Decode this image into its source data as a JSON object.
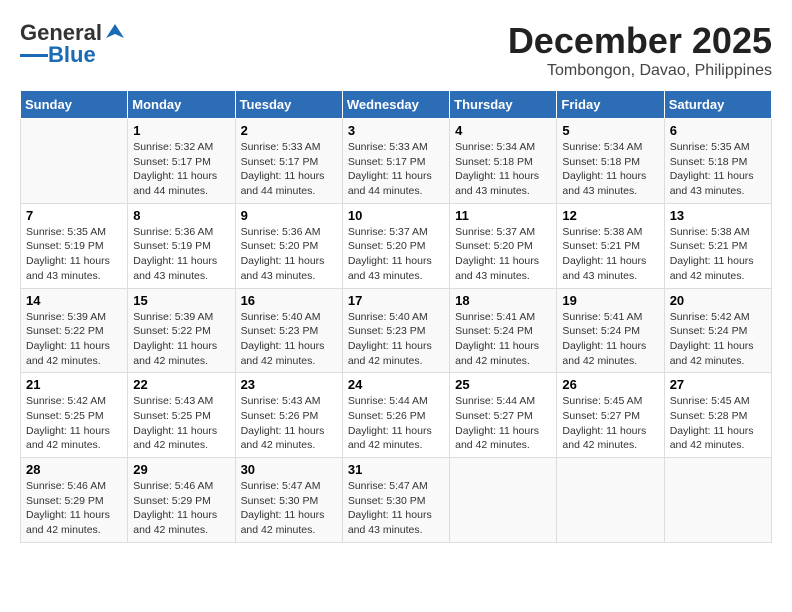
{
  "header": {
    "logo_general": "General",
    "logo_blue": "Blue",
    "title": "December 2025",
    "subtitle": "Tombongon, Davao, Philippines"
  },
  "calendar": {
    "days_of_week": [
      "Sunday",
      "Monday",
      "Tuesday",
      "Wednesday",
      "Thursday",
      "Friday",
      "Saturday"
    ],
    "weeks": [
      [
        {
          "day": "",
          "info": ""
        },
        {
          "day": "1",
          "info": "Sunrise: 5:32 AM\nSunset: 5:17 PM\nDaylight: 11 hours\nand 44 minutes."
        },
        {
          "day": "2",
          "info": "Sunrise: 5:33 AM\nSunset: 5:17 PM\nDaylight: 11 hours\nand 44 minutes."
        },
        {
          "day": "3",
          "info": "Sunrise: 5:33 AM\nSunset: 5:17 PM\nDaylight: 11 hours\nand 44 minutes."
        },
        {
          "day": "4",
          "info": "Sunrise: 5:34 AM\nSunset: 5:18 PM\nDaylight: 11 hours\nand 43 minutes."
        },
        {
          "day": "5",
          "info": "Sunrise: 5:34 AM\nSunset: 5:18 PM\nDaylight: 11 hours\nand 43 minutes."
        },
        {
          "day": "6",
          "info": "Sunrise: 5:35 AM\nSunset: 5:18 PM\nDaylight: 11 hours\nand 43 minutes."
        }
      ],
      [
        {
          "day": "7",
          "info": "Sunrise: 5:35 AM\nSunset: 5:19 PM\nDaylight: 11 hours\nand 43 minutes."
        },
        {
          "day": "8",
          "info": "Sunrise: 5:36 AM\nSunset: 5:19 PM\nDaylight: 11 hours\nand 43 minutes."
        },
        {
          "day": "9",
          "info": "Sunrise: 5:36 AM\nSunset: 5:20 PM\nDaylight: 11 hours\nand 43 minutes."
        },
        {
          "day": "10",
          "info": "Sunrise: 5:37 AM\nSunset: 5:20 PM\nDaylight: 11 hours\nand 43 minutes."
        },
        {
          "day": "11",
          "info": "Sunrise: 5:37 AM\nSunset: 5:20 PM\nDaylight: 11 hours\nand 43 minutes."
        },
        {
          "day": "12",
          "info": "Sunrise: 5:38 AM\nSunset: 5:21 PM\nDaylight: 11 hours\nand 43 minutes."
        },
        {
          "day": "13",
          "info": "Sunrise: 5:38 AM\nSunset: 5:21 PM\nDaylight: 11 hours\nand 42 minutes."
        }
      ],
      [
        {
          "day": "14",
          "info": "Sunrise: 5:39 AM\nSunset: 5:22 PM\nDaylight: 11 hours\nand 42 minutes."
        },
        {
          "day": "15",
          "info": "Sunrise: 5:39 AM\nSunset: 5:22 PM\nDaylight: 11 hours\nand 42 minutes."
        },
        {
          "day": "16",
          "info": "Sunrise: 5:40 AM\nSunset: 5:23 PM\nDaylight: 11 hours\nand 42 minutes."
        },
        {
          "day": "17",
          "info": "Sunrise: 5:40 AM\nSunset: 5:23 PM\nDaylight: 11 hours\nand 42 minutes."
        },
        {
          "day": "18",
          "info": "Sunrise: 5:41 AM\nSunset: 5:24 PM\nDaylight: 11 hours\nand 42 minutes."
        },
        {
          "day": "19",
          "info": "Sunrise: 5:41 AM\nSunset: 5:24 PM\nDaylight: 11 hours\nand 42 minutes."
        },
        {
          "day": "20",
          "info": "Sunrise: 5:42 AM\nSunset: 5:24 PM\nDaylight: 11 hours\nand 42 minutes."
        }
      ],
      [
        {
          "day": "21",
          "info": "Sunrise: 5:42 AM\nSunset: 5:25 PM\nDaylight: 11 hours\nand 42 minutes."
        },
        {
          "day": "22",
          "info": "Sunrise: 5:43 AM\nSunset: 5:25 PM\nDaylight: 11 hours\nand 42 minutes."
        },
        {
          "day": "23",
          "info": "Sunrise: 5:43 AM\nSunset: 5:26 PM\nDaylight: 11 hours\nand 42 minutes."
        },
        {
          "day": "24",
          "info": "Sunrise: 5:44 AM\nSunset: 5:26 PM\nDaylight: 11 hours\nand 42 minutes."
        },
        {
          "day": "25",
          "info": "Sunrise: 5:44 AM\nSunset: 5:27 PM\nDaylight: 11 hours\nand 42 minutes."
        },
        {
          "day": "26",
          "info": "Sunrise: 5:45 AM\nSunset: 5:27 PM\nDaylight: 11 hours\nand 42 minutes."
        },
        {
          "day": "27",
          "info": "Sunrise: 5:45 AM\nSunset: 5:28 PM\nDaylight: 11 hours\nand 42 minutes."
        }
      ],
      [
        {
          "day": "28",
          "info": "Sunrise: 5:46 AM\nSunset: 5:29 PM\nDaylight: 11 hours\nand 42 minutes."
        },
        {
          "day": "29",
          "info": "Sunrise: 5:46 AM\nSunset: 5:29 PM\nDaylight: 11 hours\nand 42 minutes."
        },
        {
          "day": "30",
          "info": "Sunrise: 5:47 AM\nSunset: 5:30 PM\nDaylight: 11 hours\nand 42 minutes."
        },
        {
          "day": "31",
          "info": "Sunrise: 5:47 AM\nSunset: 5:30 PM\nDaylight: 11 hours\nand 43 minutes."
        },
        {
          "day": "",
          "info": ""
        },
        {
          "day": "",
          "info": ""
        },
        {
          "day": "",
          "info": ""
        }
      ]
    ]
  }
}
